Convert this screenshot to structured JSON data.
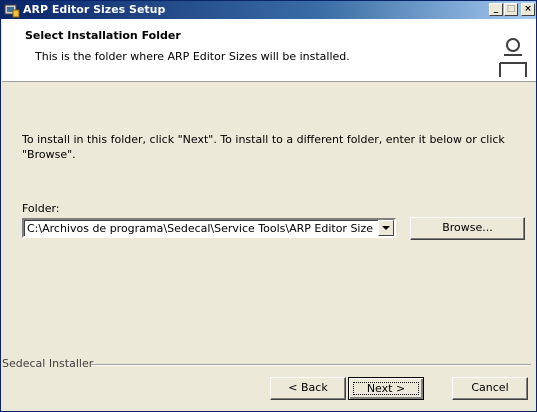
{
  "window": {
    "title": "ARP Editor Sizes Setup",
    "controls": {
      "minimize": "_",
      "maximize": "□",
      "close": "×"
    }
  },
  "banner": {
    "title": "Select Installation Folder",
    "subtitle": "This is the folder where ARP Editor Sizes will be installed.",
    "icon": "computer-user-icon"
  },
  "body": {
    "instructions": "To install in this folder, click \"Next\". To install to a different folder, enter it below or click \"Browse\".",
    "folder_label": "Folder:",
    "folder_value": "C:\\Archivos de programa\\Sedecal\\Service Tools\\ARP Editor Sizes\\"
  },
  "buttons": {
    "browse": "Browse...",
    "back": "< Back",
    "next": "Next >",
    "cancel": "Cancel"
  },
  "footer": {
    "installer_label": "Sedecal Installer"
  },
  "colors": {
    "titlebar_start": "#0a246a",
    "titlebar_end": "#a6caf0",
    "dialog_bg": "#ece9d8",
    "banner_bg": "#ffffff"
  }
}
